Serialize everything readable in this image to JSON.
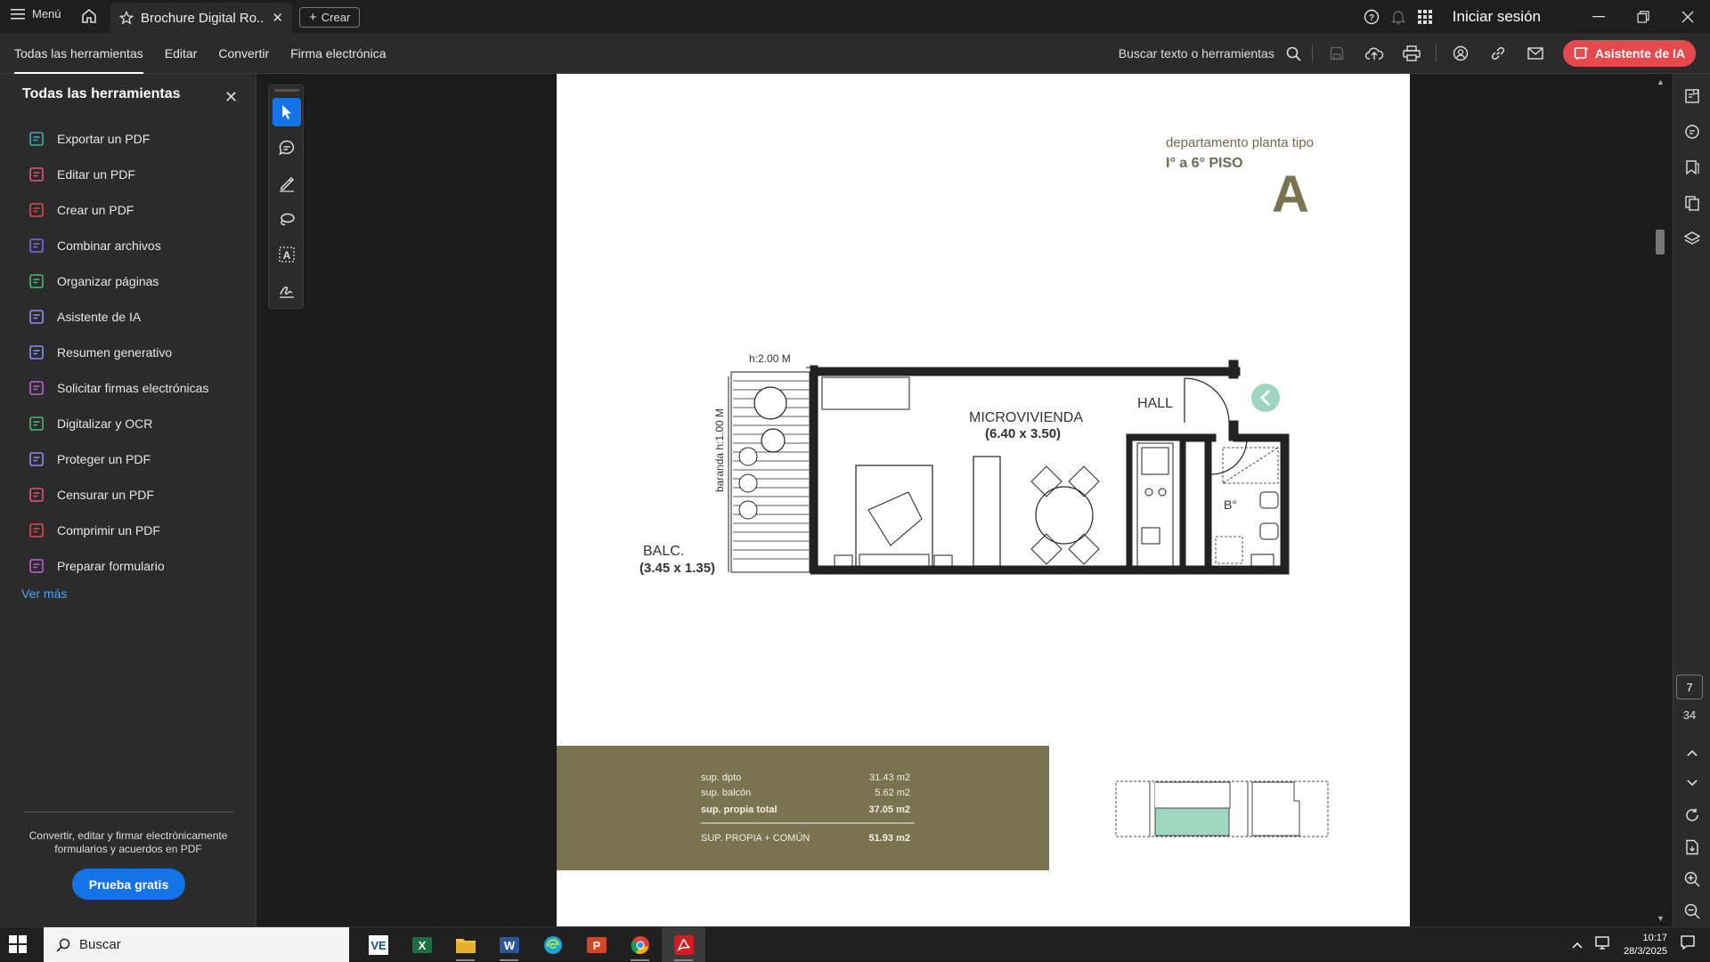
{
  "titlebar": {
    "menu_label": "Menú",
    "tab_title": "Brochure Digital Ro...",
    "create_label": "Crear",
    "signin_label": "Iniciar sesión"
  },
  "toolbar": {
    "tabs": [
      "Todas las herramientas",
      "Editar",
      "Convertir",
      "Firma electrónica"
    ],
    "search_label": "Buscar texto o herramientas",
    "ai_label": "Asistente de IA"
  },
  "left_panel": {
    "title": "Todas las herramientas",
    "items": [
      {
        "label": "Exportar un PDF",
        "icon": "export-pdf-icon",
        "color": "#38b2ac"
      },
      {
        "label": "Editar un PDF",
        "icon": "edit-pdf-icon",
        "color": "#e2587f"
      },
      {
        "label": "Crear un PDF",
        "icon": "create-pdf-icon",
        "color": "#e5484d"
      },
      {
        "label": "Combinar archivos",
        "icon": "combine-files-icon",
        "color": "#7c6cf2"
      },
      {
        "label": "Organizar páginas",
        "icon": "organize-pages-icon",
        "color": "#48bb78"
      },
      {
        "label": "Asistente de IA",
        "icon": "ai-assistant-icon",
        "color": "#8b8ff5"
      },
      {
        "label": "Resumen generativo",
        "icon": "generative-summary-icon",
        "color": "#8b8ff5"
      },
      {
        "label": "Solicitar firmas electrónicas",
        "icon": "request-signatures-icon",
        "color": "#c05fd6"
      },
      {
        "label": "Digitalizar y OCR",
        "icon": "scan-ocr-icon",
        "color": "#48bb78"
      },
      {
        "label": "Proteger un PDF",
        "icon": "protect-pdf-icon",
        "color": "#8b8ff5"
      },
      {
        "label": "Censurar un PDF",
        "icon": "redact-pdf-icon",
        "color": "#e2587f"
      },
      {
        "label": "Comprimir un PDF",
        "icon": "compress-pdf-icon",
        "color": "#e5484d"
      },
      {
        "label": "Preparar formulario",
        "icon": "prepare-form-icon",
        "color": "#c05fd6"
      }
    ],
    "more_label": "Ver más",
    "promo_text": "Convertir, editar y firmar electrónicamente formularios y acuerdos en PDF",
    "trial_label": "Prueba gratis"
  },
  "document": {
    "header_line1": "departamento planta tipo",
    "header_line2": "I° a 6° PISO",
    "unit_letter": "A",
    "label_height": "h:2.00 M",
    "label_railing": "baranda h:1.00 M",
    "label_balc": "BALC.",
    "label_balc_dims": "(3.45 x 1.35)",
    "label_room": "MICROVIVIENDA",
    "label_room_dims": "(6.40 x 3.50)",
    "label_hall": "HALL",
    "label_bath": "B°",
    "table": [
      {
        "label": "sup. dpto",
        "value": "31.43 m2"
      },
      {
        "label": "sup. balcón",
        "value": "5.62 m2"
      },
      {
        "label": "sup. propia total",
        "value": "37.05 m2"
      },
      {
        "label": "SUP. PROPIA + COMÚN",
        "value": "51.93 m2"
      }
    ],
    "accent_color": "#7a7350"
  },
  "pager": {
    "current": "7",
    "total": "34"
  },
  "taskbar": {
    "search_label": "Buscar",
    "time": "10:17",
    "date": "28/3/2025"
  }
}
